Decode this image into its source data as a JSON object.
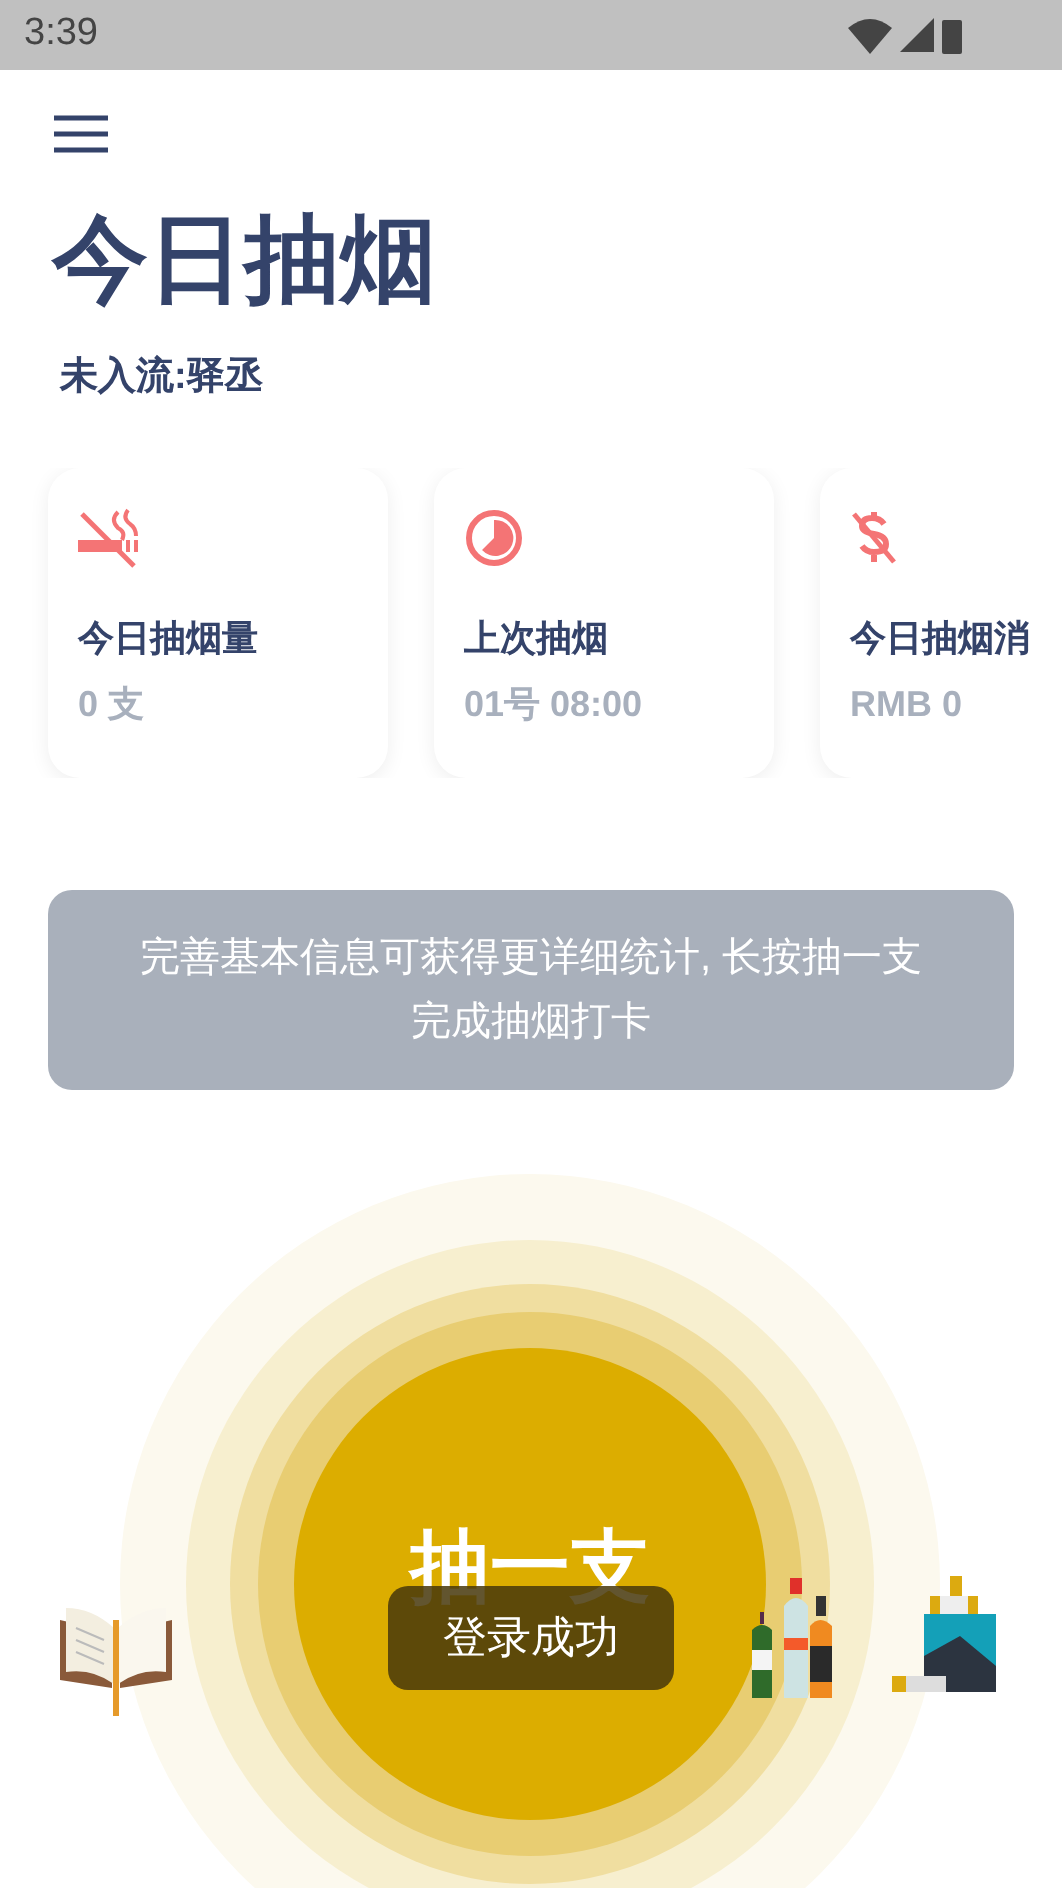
{
  "status_bar": {
    "time": "3:39"
  },
  "title": "今日抽烟",
  "subtitle": "未入流:驿丞",
  "cards": [
    {
      "kind": "no-smoking",
      "label": "今日抽烟量",
      "value": "0 支"
    },
    {
      "kind": "clock",
      "label": "上次抽烟",
      "value": "01号 08:00"
    },
    {
      "kind": "money",
      "label": "今日抽烟消",
      "value": "RMB 0"
    }
  ],
  "notice": "完善基本信息可获得更详细统计, 长按抽一支完成抽烟打卡",
  "smoke_button": {
    "label": "抽一支"
  },
  "toast": "登录成功"
}
